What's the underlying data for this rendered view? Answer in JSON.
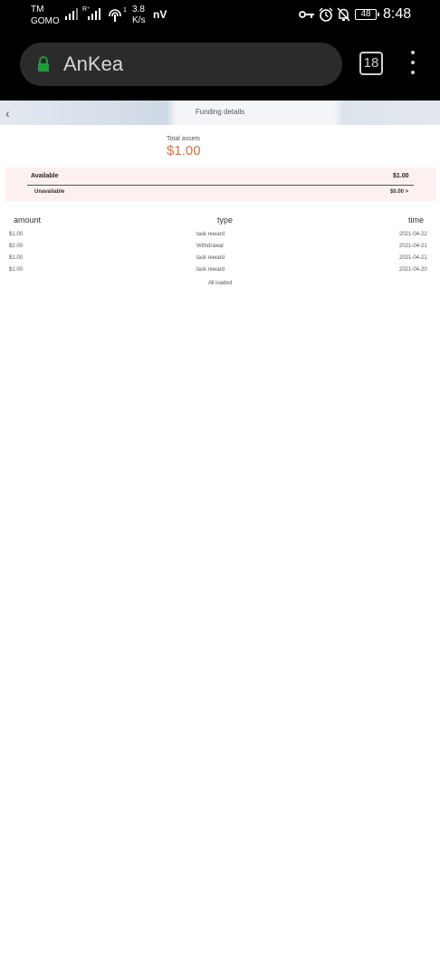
{
  "status_bar": {
    "carrier_line1": "TM",
    "carrier_line2": "GOMO",
    "signal_label": "R⁺",
    "hotspot_label": "1",
    "speed_value": "3.8",
    "speed_unit": "K/s",
    "nv_label": "nV",
    "battery": "48",
    "time": "8:48",
    "icons": [
      "signal-bars-icon",
      "signal-bars-roaming-icon",
      "hotspot-icon",
      "key-icon",
      "alarm-icon",
      "bell-off-icon",
      "battery-icon"
    ]
  },
  "browser": {
    "url_text": "AnKea",
    "tab_count": "18",
    "lock_icon": "lock-icon",
    "menu_icon": "more-vertical-icon",
    "lock_color": "#1f9d3a"
  },
  "page": {
    "title": "Funding details",
    "back_icon": "chevron-left-icon",
    "total_label": "Total assets",
    "total_value": "$1.00",
    "accent_color": "#d97043",
    "available_label": "Available",
    "available_value": "$1.00",
    "unavailable_label": "Unavailable",
    "unavailable_value": "$0.00 >",
    "columns": {
      "amount": "amount",
      "type": "type",
      "time": "time"
    },
    "rows": [
      {
        "amount": "$1.00",
        "type": "task reward",
        "time": "2021-04-22"
      },
      {
        "amount": "$2.00",
        "type": "Withdrawal",
        "time": "2021-04-21"
      },
      {
        "amount": "$1.00",
        "type": "task reward",
        "time": "2021-04-21"
      },
      {
        "amount": "$1.00",
        "type": "task reward",
        "time": "2021-04-20"
      }
    ],
    "footer": "All loaded"
  }
}
